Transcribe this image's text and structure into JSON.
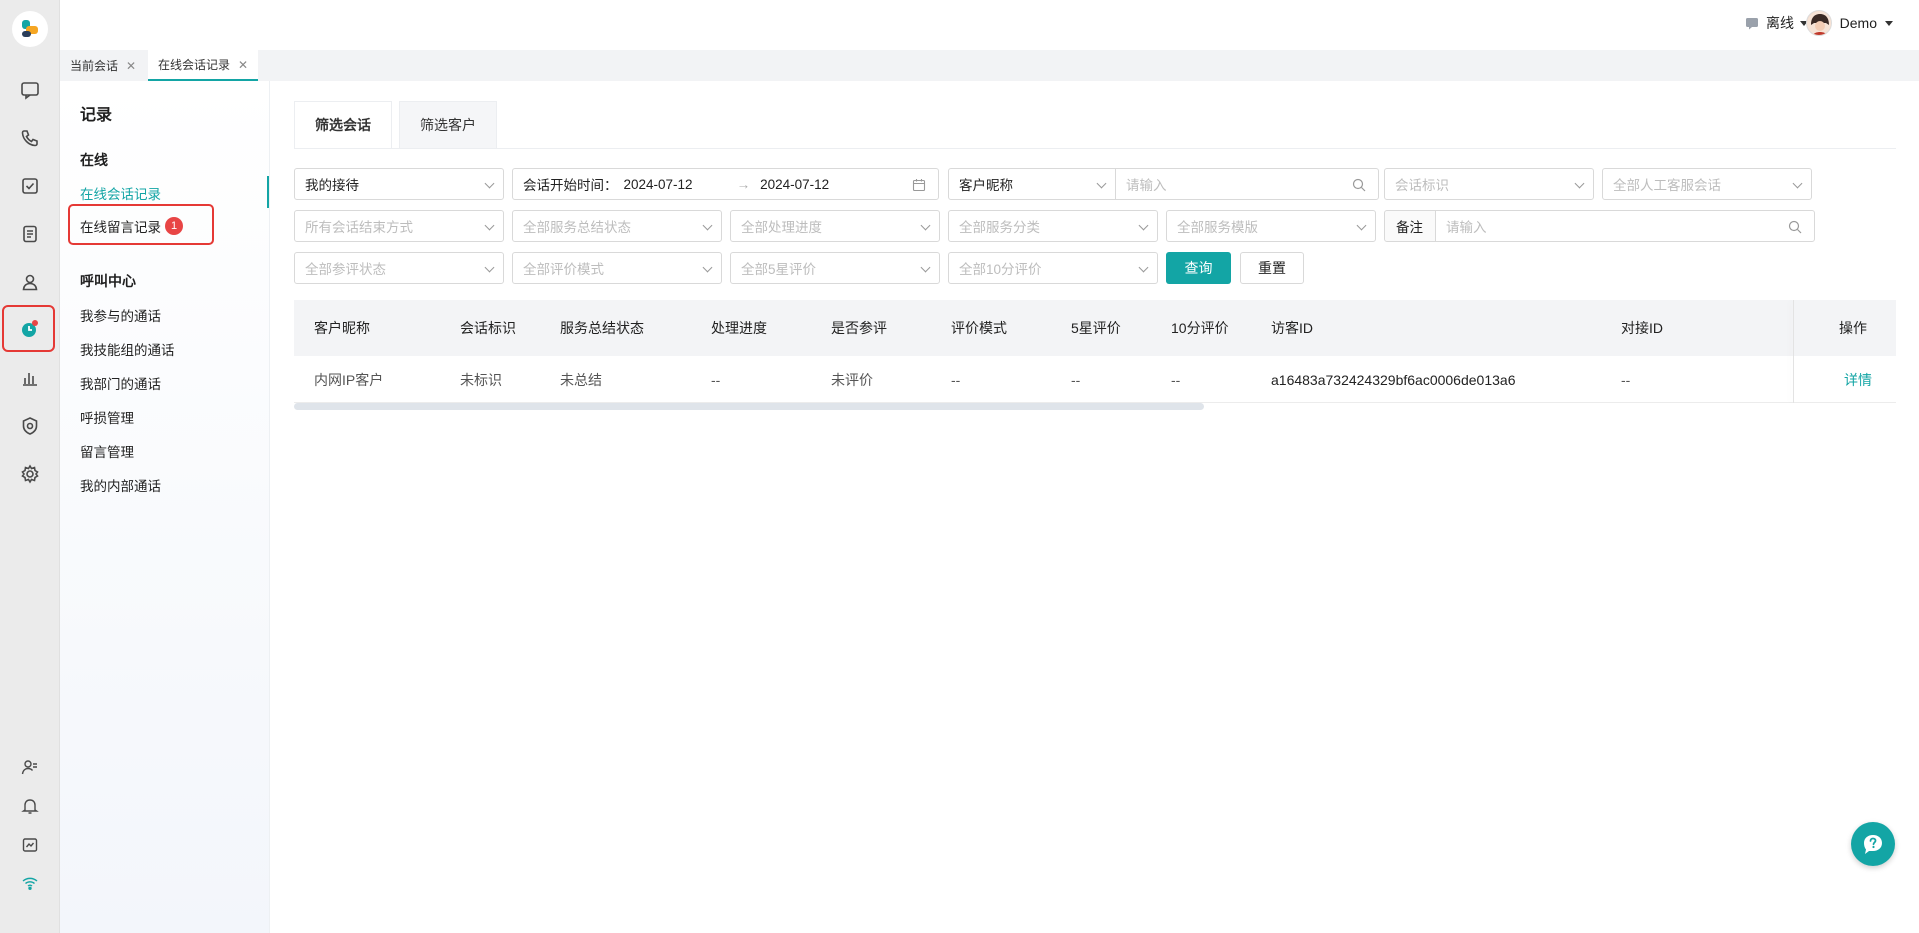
{
  "colors": {
    "accent": "#13a5a5",
    "highlight": "#e53935",
    "badge": "#e84545"
  },
  "rail": {
    "items": [
      {
        "name": "chat-icon"
      },
      {
        "name": "phone-icon"
      },
      {
        "name": "task-icon"
      },
      {
        "name": "document-icon"
      },
      {
        "name": "contacts-icon"
      },
      {
        "name": "records-icon"
      },
      {
        "name": "chart-icon"
      },
      {
        "name": "shield-icon"
      },
      {
        "name": "gear-icon"
      },
      {
        "name": "user-transfer-icon"
      },
      {
        "name": "bell-icon"
      },
      {
        "name": "monitor-icon"
      },
      {
        "name": "wifi-icon"
      }
    ]
  },
  "header": {
    "status": "离线",
    "username": "Demo"
  },
  "tabs": [
    {
      "label": "当前会话"
    },
    {
      "label": "在线会话记录"
    }
  ],
  "sidebar": {
    "title": "记录",
    "group_online": "在线",
    "online_items": [
      "在线会话记录",
      "在线留言记录"
    ],
    "badge_count": "1",
    "group_call": "呼叫中心",
    "call_items": [
      "我参与的通话",
      "我技能组的通话",
      "我部门的通话",
      "呼损管理",
      "留言管理",
      "我的内部通话"
    ]
  },
  "filter_tabs": [
    "筛选会话",
    "筛选客户"
  ],
  "filters": {
    "reception": "我的接待",
    "start_time_label": "会话开始时间：",
    "date_from": "2024-07-12",
    "date_arrow": "→",
    "date_to": "2024-07-12",
    "customer_field": "客户昵称",
    "search_placeholder": "请输入",
    "session_tag": "会话标识",
    "all_sessions": "全部人工客服会话",
    "end_method": "所有会话结束方式",
    "summary_status": "全部服务总结状态",
    "progress": "全部处理进度",
    "category": "全部服务分类",
    "template": "全部服务模版",
    "remark_label": "备注",
    "remark_placeholder": "请输入",
    "rating_status": "全部参评状态",
    "rating_mode": "全部评价模式",
    "five_star": "全部5星评价",
    "ten_point": "全部10分评价",
    "query_button": "查询",
    "reset_button": "重置"
  },
  "table": {
    "columns": [
      "客户昵称",
      "会话标识",
      "服务总结状态",
      "处理进度",
      "是否参评",
      "评价模式",
      "5星评价",
      "10分评价",
      "访客ID",
      "对接ID",
      "操作"
    ],
    "rows": [
      [
        "内网IP客户",
        "未标识",
        "未总结",
        "--",
        "未评价",
        "--",
        "--",
        "--",
        "a16483a732424329bf6ac0006de013a6",
        "--",
        "详情"
      ]
    ]
  }
}
